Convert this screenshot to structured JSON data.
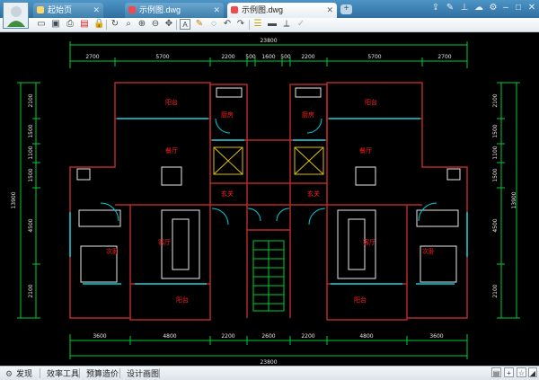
{
  "tabs": [
    {
      "label": "起始页",
      "active": false
    },
    {
      "label": "示例图.dwg",
      "active": false
    },
    {
      "label": "示例图.dwg",
      "active": true
    }
  ],
  "drawing": {
    "top_total": "23800",
    "top_dims": [
      "2700",
      "5700",
      "2200",
      "500",
      "1600",
      "500",
      "2200",
      "5700",
      "2700"
    ],
    "bottom_total": "23800",
    "bottom_dims": [
      "3600",
      "4800",
      "2200",
      "2600",
      "2200",
      "4800",
      "3600"
    ],
    "left_total": "13900",
    "left_dims": [
      "2100",
      "1500",
      "1100",
      "1500",
      "4500",
      "2100"
    ],
    "right_total": "13900",
    "right_dims": [
      "2100",
      "1500",
      "1100",
      "1500",
      "4500",
      "2100"
    ],
    "rooms": {
      "balcony": "阳台",
      "kitchen": "厨房",
      "dining": "餐厅",
      "entrance": "玄关",
      "living": "客厅",
      "bedroom": "次卧"
    }
  },
  "status": {
    "items": [
      "发现",
      "效率工具",
      "预算造价",
      "设计画图"
    ]
  },
  "colors": {
    "wall": "#b32a2a",
    "cyan": "#00ccdd",
    "green": "#00cc33",
    "white": "#e8e8e8",
    "yellow": "#e0c000",
    "label_red": "#ff2020"
  }
}
